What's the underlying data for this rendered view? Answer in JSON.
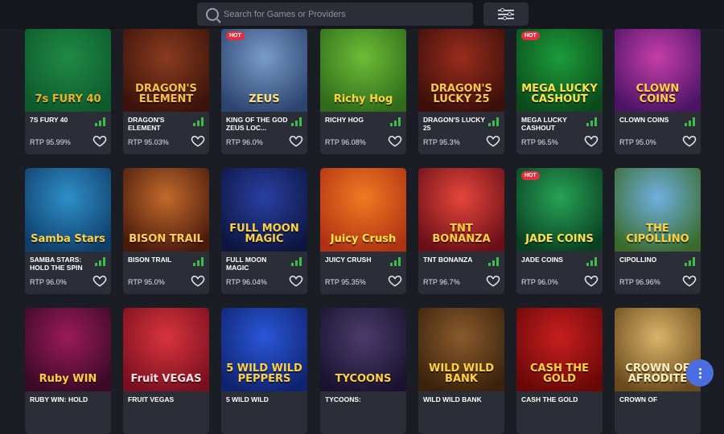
{
  "search": {
    "placeholder": "Search for Games or Providers"
  },
  "games": [
    {
      "name": "7s Fury 40",
      "rtp": "RTP 95.99%",
      "hot": "",
      "logo": "7s FURY 40",
      "bg": "#1f8a45",
      "bg2": "#0d5a2c",
      "accent": "#f1b125"
    },
    {
      "name": "Dragon's Element",
      "rtp": "RTP 95.03%",
      "hot": "",
      "logo": "DRAGON'S ELEMENT",
      "bg": "#8a3b1f",
      "bg2": "#3b130a",
      "accent": "#f5c04a"
    },
    {
      "name": "King of the God Zeus Loc...",
      "rtp": "RTP 96.0%",
      "hot": "HOT",
      "logo": "ZEUS",
      "bg": "#7a9bc9",
      "bg2": "#2c4470",
      "accent": "#ffe277"
    },
    {
      "name": "Richy Hog",
      "rtp": "RTP 96.08%",
      "hot": "",
      "logo": "Richy Hog",
      "bg": "#6dbd38",
      "bg2": "#2f6b1a",
      "accent": "#ffd23d"
    },
    {
      "name": "Dragon's Lucky 25",
      "rtp": "RTP 95.3%",
      "hot": "",
      "logo": "DRAGON'S LUCKY 25",
      "bg": "#9b2c1d",
      "bg2": "#3b0f0a",
      "accent": "#f9c94a"
    },
    {
      "name": "Mega Lucky Cashout",
      "rtp": "RTP 96.5%",
      "hot": "HOT",
      "logo": "MEGA LUCKY CASHOUT",
      "bg": "#1c9c3a",
      "bg2": "#0b4a1c",
      "accent": "#ffe04a"
    },
    {
      "name": "Clown Coins",
      "rtp": "RTP 95.0%",
      "hot": "",
      "logo": "CLOWN COINS",
      "bg": "#c63ea8",
      "bg2": "#4b1466",
      "accent": "#ffd23d"
    },
    {
      "name": "Samba Stars: Hold the Spin",
      "rtp": "RTP 96.0%",
      "hot": "",
      "logo": "Samba Stars",
      "bg": "#2f8fc9",
      "bg2": "#0f3e6a",
      "accent": "#ffd23d"
    },
    {
      "name": "Bison Trail",
      "rtp": "RTP 95.0%",
      "hot": "",
      "logo": "BISON TRAIL",
      "bg": "#c26a2c",
      "bg2": "#4a1a0c",
      "accent": "#ffcf5a"
    },
    {
      "name": "Full Moon Magic",
      "rtp": "RTP 96.04%",
      "hot": "",
      "logo": "FULL MOON MAGIC",
      "bg": "#2a3fa3",
      "bg2": "#0d1640",
      "accent": "#ffd23d"
    },
    {
      "name": "Juicy Crush",
      "rtp": "RTP 95.35%",
      "hot": "",
      "logo": "Juicy Crush",
      "bg": "#f07a23",
      "bg2": "#b03212",
      "accent": "#ffe44a"
    },
    {
      "name": "TNT Bonanza",
      "rtp": "RTP 96.7%",
      "hot": "",
      "logo": "TNT BONANZA",
      "bg": "#e6463b",
      "bg2": "#6a0f18",
      "accent": "#ffd23d"
    },
    {
      "name": "Jade Coins",
      "rtp": "RTP 96.0%",
      "hot": "HOT",
      "logo": "JADE COINS",
      "bg": "#27a355",
      "bg2": "#0a3f22",
      "accent": "#ffe04a"
    },
    {
      "name": "Cipollino",
      "rtp": "RTP 96.96%",
      "hot": "",
      "logo": "THE CIPOLLINO",
      "bg": "#6fb0e0",
      "bg2": "#3a6b2c",
      "accent": "#ffd23d"
    },
    {
      "name": "Ruby Win: Hold",
      "rtp": "",
      "hot": "",
      "logo": "Ruby WIN",
      "bg": "#9b1a5a",
      "bg2": "#3a0a26",
      "accent": "#ffd23d"
    },
    {
      "name": "Fruit Vegas",
      "rtp": "",
      "hot": "",
      "logo": "Fruit VEGAS",
      "bg": "#d8343c",
      "bg2": "#7a0f20",
      "accent": "#ffe0e0"
    },
    {
      "name": "5 Wild Wild",
      "rtp": "",
      "hot": "",
      "logo": "5 WILD WILD PEPPERS",
      "bg": "#2a56d8",
      "bg2": "#0f2370",
      "accent": "#ffd23d"
    },
    {
      "name": "Tycoons:",
      "rtp": "",
      "hot": "",
      "logo": "TYCOONS",
      "bg": "#4a3c6a",
      "bg2": "#1a1230",
      "accent": "#ffd23d"
    },
    {
      "name": "Wild Wild Bank",
      "rtp": "",
      "hot": "",
      "logo": "WILD WILD BANK",
      "bg": "#8a5a2c",
      "bg2": "#3a220c",
      "accent": "#ffd23d"
    },
    {
      "name": "Cash the Gold",
      "rtp": "",
      "hot": "",
      "logo": "CASH THE GOLD",
      "bg": "#c81e1e",
      "bg2": "#6a0808",
      "accent": "#ffd23d"
    },
    {
      "name": "Crown of",
      "rtp": "",
      "hot": "",
      "logo": "CROWN OF AFRODITE",
      "bg": "#d9b46a",
      "bg2": "#6a4a1c",
      "accent": "#fff1c0"
    }
  ]
}
